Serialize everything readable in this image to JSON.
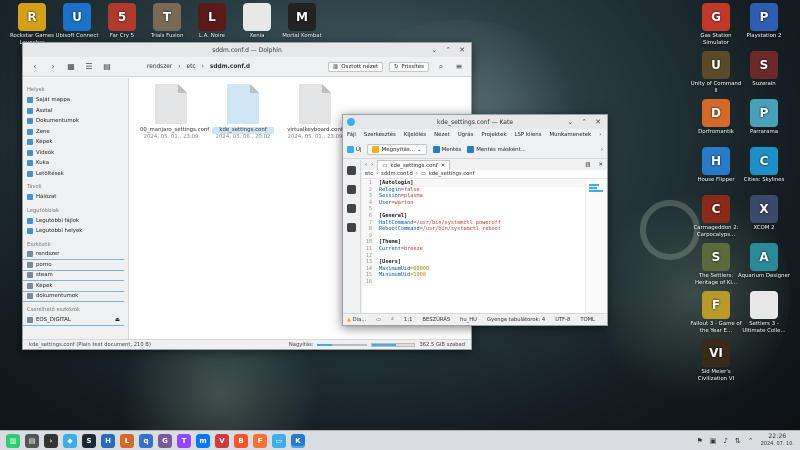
{
  "desktop": {
    "left_icons": [
      {
        "label": "Rockstar Games Launcher",
        "glyph": "R",
        "color": "#d4a017"
      },
      {
        "label": "Ubisoft Connect",
        "glyph": "U",
        "color": "#1a73c8"
      },
      {
        "label": "Far Cry 5",
        "glyph": "5",
        "color": "#b03a2e"
      },
      {
        "label": "Trials Fusion",
        "glyph": "T",
        "color": "#7a6a55"
      },
      {
        "label": "L.A. Noire",
        "glyph": "L",
        "color": "#5a1a1a"
      },
      {
        "label": "Xenia",
        "glyph": "",
        "color": "#e8e8e8"
      },
      {
        "label": "Mortal Kombat",
        "glyph": "M",
        "color": "#222222"
      }
    ],
    "right_icons": [
      {
        "label": "Gas Station Simulator",
        "glyph": "G",
        "color": "#c0392b"
      },
      {
        "label": "Playstation 2",
        "glyph": "P",
        "color": "#2f5db0"
      },
      {
        "label": "Unity of Command II",
        "glyph": "U",
        "color": "#5a4a2a"
      },
      {
        "label": "Suzerain",
        "glyph": "S",
        "color": "#6a2a2a"
      },
      {
        "label": "Dorfromantik",
        "glyph": "D",
        "color": "#d46a2a"
      },
      {
        "label": "Parrarama",
        "glyph": "P",
        "color": "#4aa0b8"
      },
      {
        "label": "House Flipper",
        "glyph": "H",
        "color": "#2a7ac8"
      },
      {
        "label": "Cities: Skylines",
        "glyph": "C",
        "color": "#1e90c8"
      },
      {
        "label": "Carmageddon 2: Carpocalyps...",
        "glyph": "C",
        "color": "#8a2a1a"
      },
      {
        "label": "XCOM 2",
        "glyph": "X",
        "color": "#3a4a6a"
      },
      {
        "label": "The Settlers: Heritage of Ki...",
        "glyph": "S",
        "color": "#5a6a3a"
      },
      {
        "label": "Aquarium Designer",
        "glyph": "A",
        "color": "#2a8a9a"
      },
      {
        "label": "Fallout 3 - Game of the Year E...",
        "glyph": "F",
        "color": "#b89a2a"
      },
      {
        "label": "Settlers 3 - Ultimate Colle...",
        "glyph": "",
        "color": "#e8e8e8"
      },
      {
        "label": "Sid Meier's Civilization VI",
        "glyph": "VI",
        "color": "#3a2a1a"
      }
    ]
  },
  "dolphin": {
    "title": "sddm.conf.d — Dolphin",
    "breadcrumbs": [
      "rendszer",
      "etc",
      "sddm.conf.d"
    ],
    "split_label": "Osztott nézet",
    "refresh_label": "Frissítés",
    "sidebar": [
      {
        "type": "section",
        "label": "Helyek"
      },
      {
        "type": "item",
        "label": "Saját mappa"
      },
      {
        "type": "item",
        "label": "Asztal"
      },
      {
        "type": "item",
        "label": "Dokumentumok"
      },
      {
        "type": "item",
        "label": "Zene"
      },
      {
        "type": "item",
        "label": "Képek"
      },
      {
        "type": "item",
        "label": "Videók"
      },
      {
        "type": "item",
        "label": "Kuka"
      },
      {
        "type": "item",
        "label": "Letöltések"
      },
      {
        "type": "section",
        "label": "Távoli"
      },
      {
        "type": "item",
        "label": "Hálózat"
      },
      {
        "type": "section",
        "label": "Legutóbbiak"
      },
      {
        "type": "item",
        "label": "Legutóbbi fájlok"
      },
      {
        "type": "item",
        "label": "Legutóbbi helyek"
      },
      {
        "type": "section",
        "label": "Eszközök"
      },
      {
        "type": "device",
        "label": "rendszer"
      },
      {
        "type": "device",
        "label": "porno"
      },
      {
        "type": "device",
        "label": "steam"
      },
      {
        "type": "device",
        "label": "Képek"
      },
      {
        "type": "device",
        "label": "dokumentumok"
      },
      {
        "type": "section",
        "label": "Cserélhető eszközök"
      },
      {
        "type": "device",
        "label": "EOS_DIGITAL"
      }
    ],
    "files": [
      {
        "name": "00_manjaro_settings.conf",
        "date": "2024. 05. 01., 23:09",
        "selected": false
      },
      {
        "name": "kde_settings.conf",
        "date": "2024. 03. 06., 20:02",
        "selected": true
      },
      {
        "name": "virtualkeyboard.conf",
        "date": "2024. 05. 01., 23:09",
        "selected": false
      }
    ],
    "status_text": "kde_settings.conf (Plain text document, 210 B)",
    "zoom_label": "Nagyítás:",
    "zoom_fraction": 0.3,
    "free_text": "362,5 GiB szabad",
    "used_fraction": 0.55
  },
  "kate": {
    "title": "kde_settings.conf — Kate",
    "menu": [
      "Fájl",
      "Szerkesztés",
      "Kijelölés",
      "Nézet",
      "Ugrás",
      "Projektek",
      "LSP kliens",
      "Munkamenetek",
      "›"
    ],
    "toolbar": {
      "new": "Új",
      "open": "Megnyitás...",
      "save": "Mentés",
      "save_as": "Mentés másként..."
    },
    "tab_label": "kde_settings.conf",
    "breadcrumb": [
      "etc",
      "sddm.conf.d",
      "kde_settings.conf"
    ],
    "lines": [
      [
        {
          "t": "[Autologin]",
          "c": "c-sec"
        }
      ],
      [
        {
          "t": "Relogin",
          "c": "c-key"
        },
        {
          "t": "=false",
          "c": "c-val"
        }
      ],
      [
        {
          "t": "Session",
          "c": "c-key"
        },
        {
          "t": "=plasma",
          "c": "c-val"
        }
      ],
      [
        {
          "t": "User",
          "c": "c-key"
        },
        {
          "t": "=warton",
          "c": "c-val"
        }
      ],
      [],
      [
        {
          "t": "[General]",
          "c": "c-sec"
        }
      ],
      [
        {
          "t": "HaltCommand",
          "c": "c-key"
        },
        {
          "t": "=/usr/bin/systemctl poweroff",
          "c": "c-val"
        }
      ],
      [
        {
          "t": "RebootCommand",
          "c": "c-key"
        },
        {
          "t": "=/usr/bin/systemctl reboot",
          "c": "c-val"
        }
      ],
      [],
      [
        {
          "t": "[Theme]",
          "c": "c-sec"
        }
      ],
      [
        {
          "t": "Current",
          "c": "c-key"
        },
        {
          "t": "=breeze",
          "c": "c-val"
        }
      ],
      [],
      [
        {
          "t": "[Users]",
          "c": "c-sec"
        }
      ],
      [
        {
          "t": "MaximumUid",
          "c": "c-key"
        },
        {
          "t": "=60000",
          "c": "c-num"
        }
      ],
      [
        {
          "t": "MinimumUid",
          "c": "c-key"
        },
        {
          "t": "=1000",
          "c": "c-num"
        }
      ],
      []
    ],
    "status": {
      "diag": "Dia...",
      "pos": "1:1",
      "mode": "BESZÚRÁS",
      "lang": "hu_HU",
      "indent": "Gyenge tabulátorok: 4",
      "enc": "UTF-8",
      "syntax": "TOML"
    }
  },
  "taskbar": {
    "apps": [
      {
        "name": "app-launcher-icon",
        "color": "#2ecc71",
        "glyph": "▥"
      },
      {
        "name": "pager-icon",
        "color": "#555555",
        "glyph": "▤"
      },
      {
        "name": "konsole-icon",
        "color": "#333333",
        "glyph": "›"
      },
      {
        "name": "discover-icon",
        "color": "#3daee9",
        "glyph": "◆"
      },
      {
        "name": "steam-icon",
        "color": "#1b2838",
        "glyph": "S"
      },
      {
        "name": "heroic-icon",
        "color": "#2a6ab8",
        "glyph": "H"
      },
      {
        "name": "lutris-icon",
        "color": "#d46a2a",
        "glyph": "L"
      },
      {
        "name": "qbittorrent-icon",
        "color": "#3a70c8",
        "glyph": "q"
      },
      {
        "name": "gimp-icon",
        "color": "#7a5a9a",
        "glyph": "G"
      },
      {
        "name": "twitch-icon",
        "color": "#9146ff",
        "glyph": "T"
      },
      {
        "name": "messenger-icon",
        "color": "#0078ff",
        "glyph": "m"
      },
      {
        "name": "vivaldi-icon",
        "color": "#d03a3a",
        "glyph": "V"
      },
      {
        "name": "brave-icon",
        "color": "#fb542b",
        "glyph": "B"
      },
      {
        "name": "firefox-icon",
        "color": "#ff7139",
        "glyph": "F"
      },
      {
        "name": "dolphin-task-icon",
        "color": "#3daee9",
        "glyph": "▭",
        "active": true
      },
      {
        "name": "kate-task-icon",
        "color": "#2a7ac8",
        "glyph": "K",
        "active": true
      }
    ],
    "time": "22:26",
    "date": "2024. 07. 10."
  }
}
